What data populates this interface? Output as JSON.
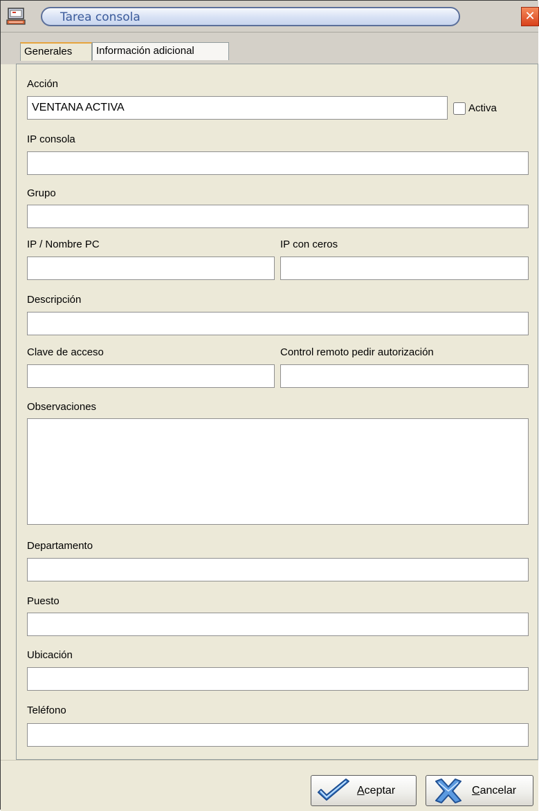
{
  "window": {
    "title": "Tarea consola",
    "close_symbol": "✕"
  },
  "tabs": [
    {
      "label": "Generales",
      "active": true
    },
    {
      "label": "Información adicional",
      "active": false
    }
  ],
  "form": {
    "accion": {
      "label": "Acción",
      "value": "VENTANA ACTIVA"
    },
    "activa": {
      "label": "Activa",
      "checked": false
    },
    "ip_consola": {
      "label": "IP consola",
      "value": ""
    },
    "grupo": {
      "label": "Grupo",
      "value": ""
    },
    "ip_nombre_pc": {
      "label": "IP / Nombre PC",
      "value": ""
    },
    "ip_con_ceros": {
      "label": "IP con ceros",
      "value": ""
    },
    "descripcion": {
      "label": "Descripción",
      "value": ""
    },
    "clave_acceso": {
      "label": "Clave de acceso",
      "value": ""
    },
    "control_remoto": {
      "label": "Control remoto pedir autorización",
      "value": ""
    },
    "observaciones": {
      "label": "Observaciones",
      "value": ""
    },
    "departamento": {
      "label": "Departamento",
      "value": ""
    },
    "puesto": {
      "label": "Puesto",
      "value": ""
    },
    "ubicacion": {
      "label": "Ubicación",
      "value": ""
    },
    "telefono": {
      "label": "Teléfono",
      "value": ""
    }
  },
  "buttons": {
    "accept": {
      "label": "Aceptar",
      "icon": "checkmark-icon",
      "color": "#3a78c8"
    },
    "cancel": {
      "label": "Cancelar",
      "icon": "x-cross-icon",
      "color": "#4a86d0"
    }
  },
  "colors": {
    "accent": "#5b6f9a",
    "close": "#d8411b",
    "tab_highlight": "#e6a43c"
  }
}
